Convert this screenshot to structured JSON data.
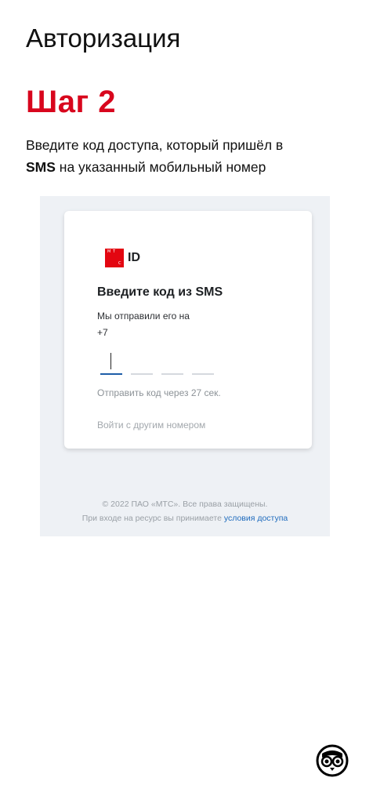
{
  "page": {
    "title": "Авторизация",
    "step_title": "Шаг 2",
    "desc_part1": "Введите код доступа, который пришёл в",
    "desc_sms": "SMS",
    "desc_part2": " на указанный мобильный номер"
  },
  "screenshot": {
    "logo": {
      "mark_letters": [
        "М",
        "Т",
        "С"
      ],
      "id_text": "ID"
    },
    "heading": "Введите код из SMS",
    "subtitle": "Мы отправили его на",
    "phone": "+7",
    "code_cells": 4,
    "resend_text": "Отправить код через 27 сек.",
    "other_number_link": "Войти с другим номером",
    "footer_copyright": "© 2022 ПАО «МТС». Все права защищены.",
    "footer_terms_prefix": "При входе на ресурс вы принимаете ",
    "footer_terms_link": "условия доступа"
  },
  "colors": {
    "step_red": "#d8061d",
    "mts_red": "#e30611",
    "link_blue": "#1e6bbd",
    "active_underline": "#1e5da8"
  },
  "icons": {
    "corner_logo": "owl-icon"
  }
}
